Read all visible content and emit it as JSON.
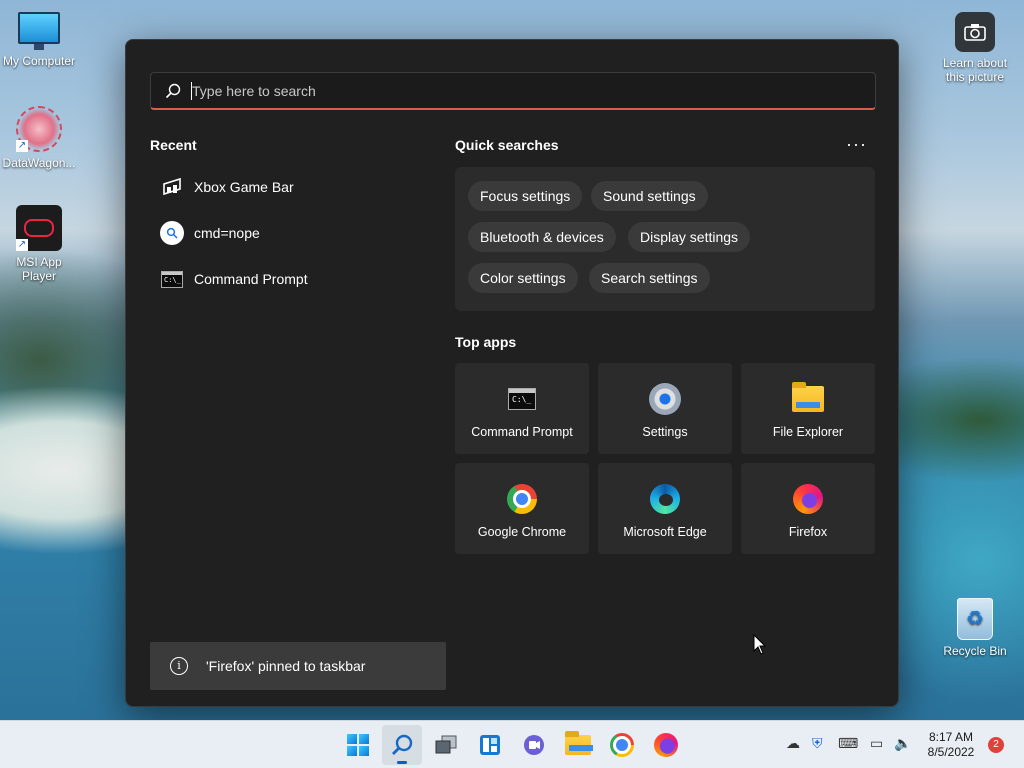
{
  "desktop": {
    "icons": [
      {
        "label": "My Computer"
      },
      {
        "label": "DataWagon..."
      },
      {
        "label": "MSI App Player"
      },
      {
        "label": "Learn about this picture"
      },
      {
        "label": "Recycle Bin"
      }
    ]
  },
  "search": {
    "placeholder": "Type here to search",
    "value": ""
  },
  "recent": {
    "title": "Recent",
    "items": [
      {
        "label": "Xbox Game Bar",
        "icon": "xbox-game-bar-icon"
      },
      {
        "label": "cmd=nope",
        "icon": "search-icon"
      },
      {
        "label": "Command Prompt",
        "icon": "command-prompt-icon"
      }
    ]
  },
  "quick_searches": {
    "title": "Quick searches",
    "more_label": "···",
    "chips": [
      {
        "label": "Focus settings"
      },
      {
        "label": "Sound settings"
      },
      {
        "label": "Bluetooth & devices"
      },
      {
        "label": "Display settings"
      },
      {
        "label": "Color settings"
      },
      {
        "label": "Search settings"
      }
    ]
  },
  "top_apps": {
    "title": "Top apps",
    "apps": [
      {
        "label": "Command Prompt",
        "icon": "command-prompt-icon"
      },
      {
        "label": "Settings",
        "icon": "gear-icon"
      },
      {
        "label": "File Explorer",
        "icon": "folder-icon"
      },
      {
        "label": "Google Chrome",
        "icon": "chrome-icon"
      },
      {
        "label": "Microsoft Edge",
        "icon": "edge-icon"
      },
      {
        "label": "Firefox",
        "icon": "firefox-icon"
      }
    ]
  },
  "toast": {
    "message": "'Firefox' pinned to taskbar"
  },
  "taskbar": {
    "time": "8:17 AM",
    "date": "8/5/2022",
    "notification_count": "2",
    "accent": "#0a5fc0"
  },
  "colors": {
    "search_underline": "#e05c4a",
    "panel_bg": "#202020"
  }
}
